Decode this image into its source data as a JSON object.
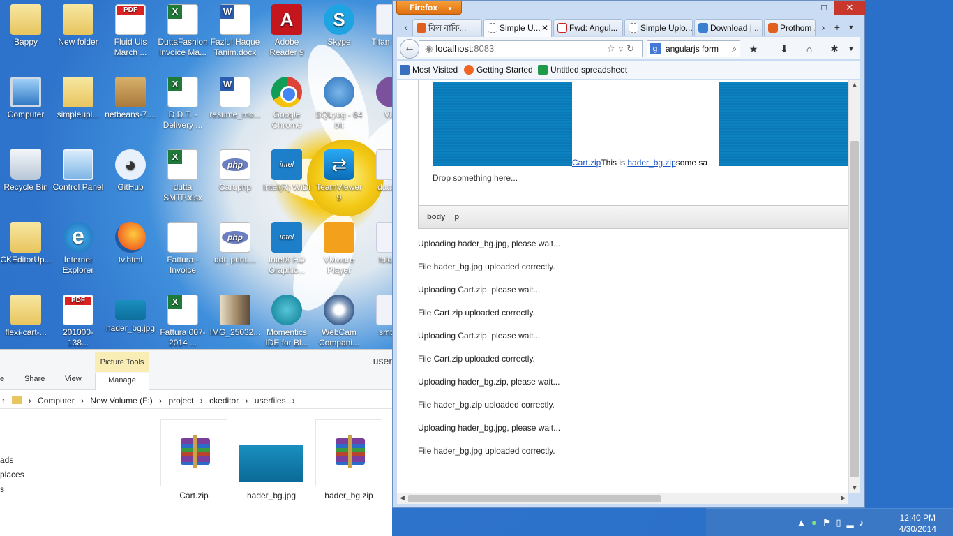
{
  "desktop": {
    "icons": [
      {
        "label": "Bappy",
        "type": "folder"
      },
      {
        "label": "New folder",
        "type": "folder"
      },
      {
        "label": "Fluid Uis March ...",
        "type": "pdf"
      },
      {
        "label": "DuttaFashion Invoice Ma...",
        "type": "excel"
      },
      {
        "label": "Fazlul Haque Tanim.docx",
        "type": "word"
      },
      {
        "label": "Adobe Reader 9",
        "type": "adobe"
      },
      {
        "label": "Skype",
        "type": "skype"
      },
      {
        "label": "Titan Stu...",
        "type": "generic"
      },
      {
        "label": "Computer",
        "type": "computer"
      },
      {
        "label": "simpleupl...",
        "type": "folder"
      },
      {
        "label": "netbeans-7....",
        "type": "box"
      },
      {
        "label": "D.D.T. -Delivery ...",
        "type": "excel"
      },
      {
        "label": "resume_mo...",
        "type": "word"
      },
      {
        "label": "Google Chrome",
        "type": "chrome"
      },
      {
        "label": "SQLyog - 64 bit",
        "type": "dolphin"
      },
      {
        "label": "Vi...",
        "type": "viber"
      },
      {
        "label": "Recycle Bin",
        "type": "recycle"
      },
      {
        "label": "Control Panel",
        "type": "panel"
      },
      {
        "label": "GitHub",
        "type": "github"
      },
      {
        "label": "dutta SMTP.xlsx",
        "type": "excel"
      },
      {
        "label": "Cart.php",
        "type": "php"
      },
      {
        "label": "Intel(R) WiDi",
        "type": "intel"
      },
      {
        "label": "TeamViewer 9",
        "type": "teamviewer"
      },
      {
        "label": "duttaf...",
        "type": "generic"
      },
      {
        "label": "CKEditorUp...",
        "type": "folder"
      },
      {
        "label": "Internet Explorer",
        "type": "ie"
      },
      {
        "label": "tv.html",
        "type": "firefox"
      },
      {
        "label": "Fattura - Invoice S.r.l....",
        "type": "html"
      },
      {
        "label": "ddt_print....",
        "type": "php"
      },
      {
        "label": "Intel® HD Graphic...",
        "type": "intel"
      },
      {
        "label": "VMware Player",
        "type": "vmware"
      },
      {
        "label": "folde...",
        "type": "generic"
      },
      {
        "label": "flexi-cart-...",
        "type": "folder"
      },
      {
        "label": "201000-138...",
        "type": "pdf"
      },
      {
        "label": "hader_bg.jpg",
        "type": "thumb"
      },
      {
        "label": "Fattura 007-2014 ...",
        "type": "excel"
      },
      {
        "label": "IMG_25032...",
        "type": "photo"
      },
      {
        "label": "Momentics IDE for Bl...",
        "type": "momentics"
      },
      {
        "label": "WebCam Compani...",
        "type": "webcam"
      },
      {
        "label": "smtp...",
        "type": "generic"
      }
    ]
  },
  "explorer": {
    "context_tab": "Picture Tools",
    "title_partial": "user",
    "ribbon_tabs": [
      "e",
      "Share",
      "View",
      "Manage"
    ],
    "path": [
      "Computer",
      "New Volume (F:)",
      "project",
      "ckeditor",
      "userfiles"
    ],
    "nav_items": [
      "ads",
      "places",
      "s"
    ],
    "files": [
      {
        "name": "Cart.zip",
        "kind": "rar"
      },
      {
        "name": "hader_bg.jpg",
        "kind": "jpg"
      },
      {
        "name": "hader_bg.zip",
        "kind": "rar"
      }
    ]
  },
  "firefox": {
    "menu_button": "Firefox",
    "tabs": [
      {
        "title": "বিল বাকি...",
        "fav_color": "#e06020",
        "active": false
      },
      {
        "title": "Simple U...",
        "fav_color": "#ffffff",
        "active": true
      },
      {
        "title": "Fwd: Angul...",
        "fav_color": "#cc2222",
        "active": false
      },
      {
        "title": "Simple Uplo...",
        "fav_color": "#ffffff",
        "active": false
      },
      {
        "title": "Download | ...",
        "fav_color": "#3a7fd0",
        "active": false
      },
      {
        "title": "Prothom ...",
        "fav_color": "#e06020",
        "active": false
      }
    ],
    "url_host": "localhost",
    "url_port": ":8083",
    "search_engine": "g",
    "search_text": "angularjs form",
    "bookmarks": [
      {
        "label": "Most Visited",
        "color": "#3a6fc0"
      },
      {
        "label": "Getting Started",
        "color": "#f06524"
      },
      {
        "label": "Untitled spreadsheet",
        "color": "#1f9a48"
      }
    ]
  },
  "editor": {
    "link1": "Cart.zip",
    "text1": "This is ",
    "link2": "hader_bg.zip",
    "text2": "some sa",
    "drop_text": "Drop something here...",
    "path_elements": "body p"
  },
  "upload_log": [
    "Uploading hader_bg.jpg, please wait...",
    "File hader_bg.jpg uploaded correctly.",
    "Uploading Cart.zip, please wait...",
    "File Cart.zip uploaded correctly.",
    "Uploading Cart.zip, please wait...",
    "File Cart.zip uploaded correctly.",
    "Uploading hader_bg.zip, please wait...",
    "File hader_bg.zip uploaded correctly.",
    "Uploading hader_bg.jpg, please wait...",
    "File hader_bg.jpg uploaded correctly."
  ],
  "taskbar": {
    "time": "12:40 PM",
    "date": "4/30/2014"
  }
}
